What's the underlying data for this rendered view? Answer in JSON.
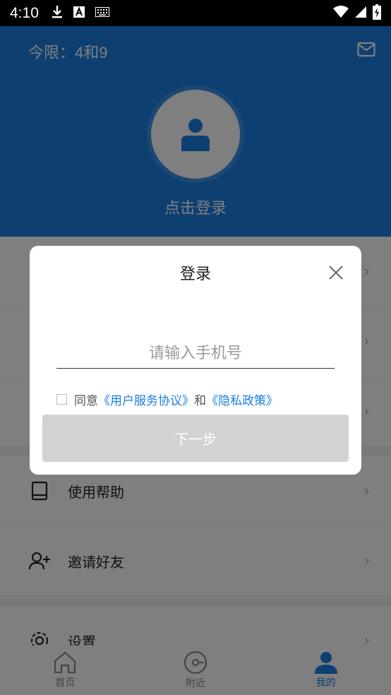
{
  "status_bar": {
    "time": "4:10"
  },
  "header": {
    "limit_text": "今限：4和9",
    "login_prompt": "点击登录"
  },
  "menu": {
    "items": [
      {
        "label": "使用帮助"
      },
      {
        "label": "邀请好友"
      },
      {
        "label": "设置"
      }
    ]
  },
  "tabbar": {
    "tabs": [
      {
        "label": "首页"
      },
      {
        "label": "附近"
      },
      {
        "label": "我的"
      }
    ]
  },
  "dialog": {
    "title": "登录",
    "phone_placeholder": "请输入手机号",
    "agree_prefix": "同意",
    "agree_link1": "《用户服务协议》",
    "agree_and": "和",
    "agree_link2": "《隐私政策》",
    "next_label": "下一步"
  },
  "colors": {
    "accent": "#1a7ee2",
    "disabled_button": "#d2d2d2"
  }
}
